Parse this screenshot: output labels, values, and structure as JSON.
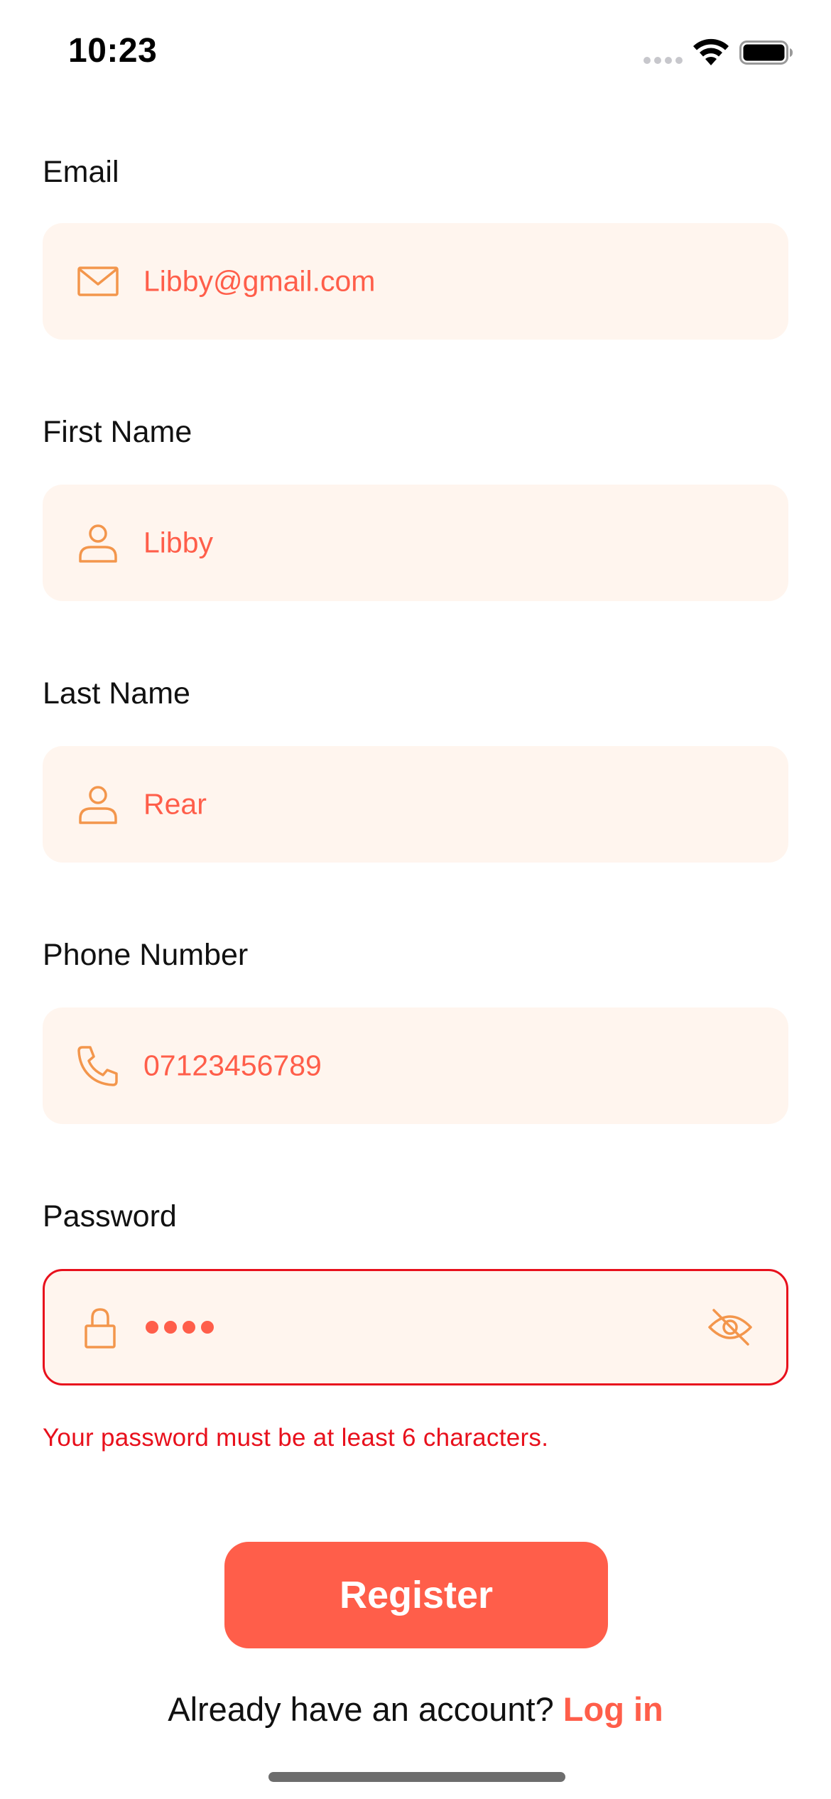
{
  "status_bar": {
    "time": "10:23",
    "icons": [
      "cellular-signal-icon",
      "wifi-icon",
      "battery-icon"
    ]
  },
  "colors": {
    "accent": "#ff5e4a",
    "icon": "#f3964c",
    "field_bg": "#fff5ee",
    "error": "#e8101c"
  },
  "form": {
    "email": {
      "label": "Email",
      "value": "Libby@gmail.com",
      "icon": "envelope-icon"
    },
    "first_name": {
      "label": "First Name",
      "value": "Libby",
      "icon": "person-icon"
    },
    "last_name": {
      "label": "Last Name",
      "value": "Rear",
      "icon": "person-icon"
    },
    "phone": {
      "label": "Phone Number",
      "value": "07123456789",
      "icon": "phone-icon"
    },
    "password": {
      "label": "Password",
      "masked_value": "••••",
      "icon": "lock-icon",
      "toggle_icon": "eye-slash-icon",
      "error": "Your password must be at least 6 characters."
    }
  },
  "actions": {
    "register_label": "Register",
    "login_prompt": "Already have an account?",
    "login_link": "Log in"
  }
}
